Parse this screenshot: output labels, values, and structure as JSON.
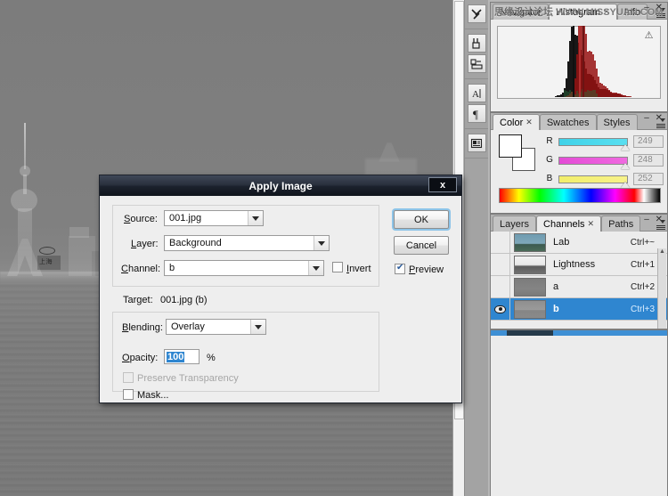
{
  "dialog": {
    "title": "Apply Image",
    "close_label": "x",
    "source_label": "Source:",
    "source_value": "001.jpg",
    "layer_label": "Layer:",
    "layer_value": "Background",
    "channel_label": "Channel:",
    "channel_value": "b",
    "invert_label": "Invert",
    "invert_checked": false,
    "target_label": "Target:",
    "target_value": "001.jpg (b)",
    "blending_label": "Blending:",
    "blending_value": "Overlay",
    "opacity_label": "Opacity:",
    "opacity_value": "100",
    "percent_label": "%",
    "preserve_label": "Preserve Transparency",
    "preserve_checked": false,
    "preserve_enabled": false,
    "mask_label": "Mask...",
    "mask_checked": false,
    "ok_label": "OK",
    "cancel_label": "Cancel",
    "preview_label": "Preview",
    "preview_checked": true
  },
  "histogram_panel": {
    "tabs": [
      {
        "label": "Navigator",
        "active": false,
        "closable": false
      },
      {
        "label": "Histogram",
        "active": true,
        "closable": true
      },
      {
        "label": "Info",
        "active": false,
        "closable": false
      }
    ],
    "warning_icon": "warning-triangle-icon",
    "watermark_cn": "思缘设计论坛",
    "watermark_en": "WWW.MISSYUAN.COM"
  },
  "color_panel": {
    "tabs": [
      {
        "label": "Color",
        "active": true,
        "closable": true
      },
      {
        "label": "Swatches",
        "active": false,
        "closable": false
      },
      {
        "label": "Styles",
        "active": false,
        "closable": false
      }
    ],
    "channels": [
      {
        "label": "R",
        "value": "249"
      },
      {
        "label": "G",
        "value": "248"
      },
      {
        "label": "B",
        "value": "252"
      }
    ],
    "foreground_color": "#ffffff",
    "background_color": "#ffffff"
  },
  "channels_panel": {
    "tabs": [
      {
        "label": "Layers",
        "active": false,
        "closable": false
      },
      {
        "label": "Channels",
        "active": true,
        "closable": true
      },
      {
        "label": "Paths",
        "active": false,
        "closable": false
      }
    ],
    "rows": [
      {
        "name": "Lab",
        "shortcut": "Ctrl+~",
        "visible": false,
        "selected": false
      },
      {
        "name": "Lightness",
        "shortcut": "Ctrl+1",
        "visible": false,
        "selected": false
      },
      {
        "name": "a",
        "shortcut": "Ctrl+2",
        "visible": false,
        "selected": false
      },
      {
        "name": "b",
        "shortcut": "Ctrl+3",
        "visible": true,
        "selected": true
      }
    ],
    "selection_color": "#2f86d0"
  },
  "icon_dock": {
    "items": [
      {
        "name": "tool-presets-icon",
        "glyph": "⚒"
      },
      {
        "name": "brushes-icon",
        "glyph": "⑁"
      },
      {
        "name": "clone-source-icon",
        "glyph": "⊟"
      },
      {
        "name": "character-icon",
        "glyph": "A"
      },
      {
        "name": "paragraph-icon",
        "glyph": "¶"
      },
      {
        "name": "layer-comps-icon",
        "glyph": "▤"
      }
    ]
  },
  "canvas": {
    "description": "grayscale b-channel view of Shanghai skyline with Oriental Pearl Tower",
    "sign_text": "上海"
  }
}
